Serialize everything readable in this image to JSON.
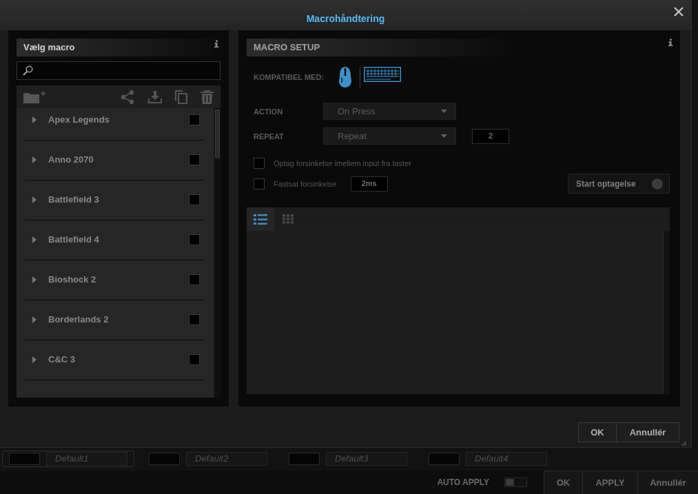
{
  "dialog": {
    "title": "Macrohåndtering"
  },
  "macro_list": {
    "title": "Vælg macro",
    "items": [
      {
        "label": "Apex Legends",
        "expanded": false,
        "checked": false
      },
      {
        "label": "Anno 2070",
        "expanded": false,
        "checked": false
      },
      {
        "label": "Battlefield 3",
        "expanded": false,
        "checked": false
      },
      {
        "label": "Battlefield 4",
        "expanded": false,
        "checked": false
      },
      {
        "label": "Bioshock 2",
        "expanded": false,
        "checked": false
      },
      {
        "label": "Borderlands 2",
        "expanded": false,
        "checked": false
      },
      {
        "label": "C&C 3",
        "expanded": false,
        "checked": false
      }
    ]
  },
  "macro_setup": {
    "title": "MACRO SETUP",
    "compatible_label": "KOMPATIBEL MED:",
    "action": {
      "label": "ACTION",
      "value": "On Press"
    },
    "repeat": {
      "label": "REPEAT",
      "value": "Repeat",
      "count": "2"
    },
    "options": [
      {
        "label": "Optag forsinkelse imellem input fra taster",
        "checked": false
      },
      {
        "label": "Fastsat forsinkelse",
        "checked": false,
        "delay": "2ms"
      }
    ],
    "record_button": "Start optagelse",
    "view_tabs": [
      {
        "kind": "list",
        "selected": true
      },
      {
        "kind": "grid",
        "selected": false
      }
    ]
  },
  "dialog_buttons": [
    "OK",
    "Annullér"
  ],
  "profiles": [
    {
      "name": "Default1",
      "selected": true
    },
    {
      "name": "Default2",
      "selected": false
    },
    {
      "name": "Default3",
      "selected": false
    },
    {
      "name": "Default4",
      "selected": false
    }
  ],
  "footer": {
    "auto_apply": {
      "label": "AUTO APPLY",
      "on": false
    },
    "buttons": [
      "OK",
      "APPLY",
      "Annullér"
    ]
  }
}
